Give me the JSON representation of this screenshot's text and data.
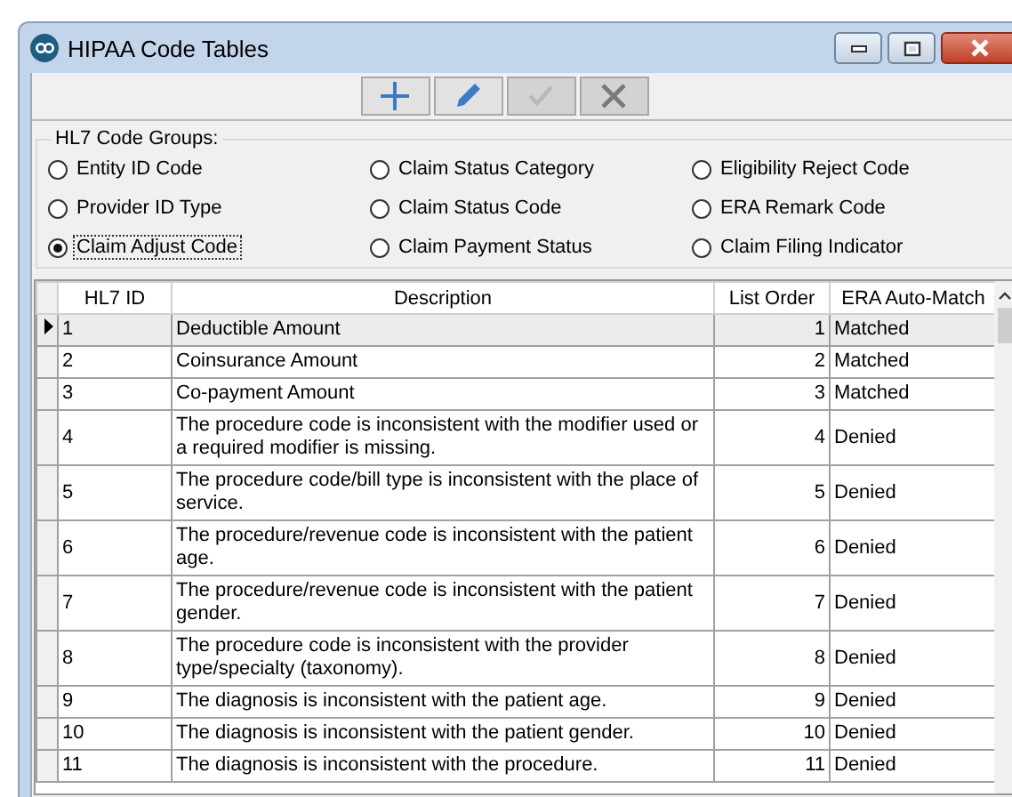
{
  "window": {
    "title": "HIPAA Code Tables"
  },
  "toolbar": [
    {
      "kind": "add",
      "disabled": false
    },
    {
      "kind": "edit",
      "disabled": false
    },
    {
      "kind": "save",
      "disabled": true
    },
    {
      "kind": "cancel",
      "disabled": true
    }
  ],
  "code_groups": {
    "label": "HL7 Code Groups:",
    "options": [
      {
        "label": "Entity ID Code",
        "selected": false
      },
      {
        "label": "Claim Status Category",
        "selected": false
      },
      {
        "label": "Eligibility Reject Code",
        "selected": false
      },
      {
        "label": "Provider ID Type",
        "selected": false
      },
      {
        "label": "Claim Status Code",
        "selected": false
      },
      {
        "label": "ERA Remark Code",
        "selected": false
      },
      {
        "label": "Claim Adjust Code",
        "selected": true
      },
      {
        "label": "Claim Payment Status",
        "selected": false
      },
      {
        "label": "Claim Filing Indicator",
        "selected": false
      }
    ]
  },
  "table": {
    "columns": [
      "HL7 ID",
      "Description",
      "List Order",
      "ERA Auto-Match"
    ],
    "rows": [
      {
        "id": "1",
        "description": "Deductible Amount",
        "order": "1",
        "match": "Matched",
        "selected": true
      },
      {
        "id": "2",
        "description": "Coinsurance Amount",
        "order": "2",
        "match": "Matched",
        "selected": false
      },
      {
        "id": "3",
        "description": "Co-payment Amount",
        "order": "3",
        "match": "Matched",
        "selected": false
      },
      {
        "id": "4",
        "description": "The procedure code is inconsistent with the modifier used or a required modifier is missing.",
        "order": "4",
        "match": "Denied",
        "selected": false
      },
      {
        "id": "5",
        "description": "The procedure code/bill type is inconsistent with the place of service.",
        "order": "5",
        "match": "Denied",
        "selected": false
      },
      {
        "id": "6",
        "description": "The procedure/revenue code is inconsistent with the patient age.",
        "order": "6",
        "match": "Denied",
        "selected": false
      },
      {
        "id": "7",
        "description": "The procedure/revenue code is inconsistent with the patient gender.",
        "order": "7",
        "match": "Denied",
        "selected": false
      },
      {
        "id": "8",
        "description": "The procedure code is inconsistent with the provider type/specialty (taxonomy).",
        "order": "8",
        "match": "Denied",
        "selected": false
      },
      {
        "id": "9",
        "description": "The diagnosis is inconsistent with the patient age.",
        "order": "9",
        "match": "Denied",
        "selected": false
      },
      {
        "id": "10",
        "description": "The diagnosis is inconsistent with the patient gender.",
        "order": "10",
        "match": "Denied",
        "selected": false
      },
      {
        "id": "11",
        "description": "The diagnosis is inconsistent with the procedure.",
        "order": "11",
        "match": "Denied",
        "selected": false
      }
    ]
  }
}
